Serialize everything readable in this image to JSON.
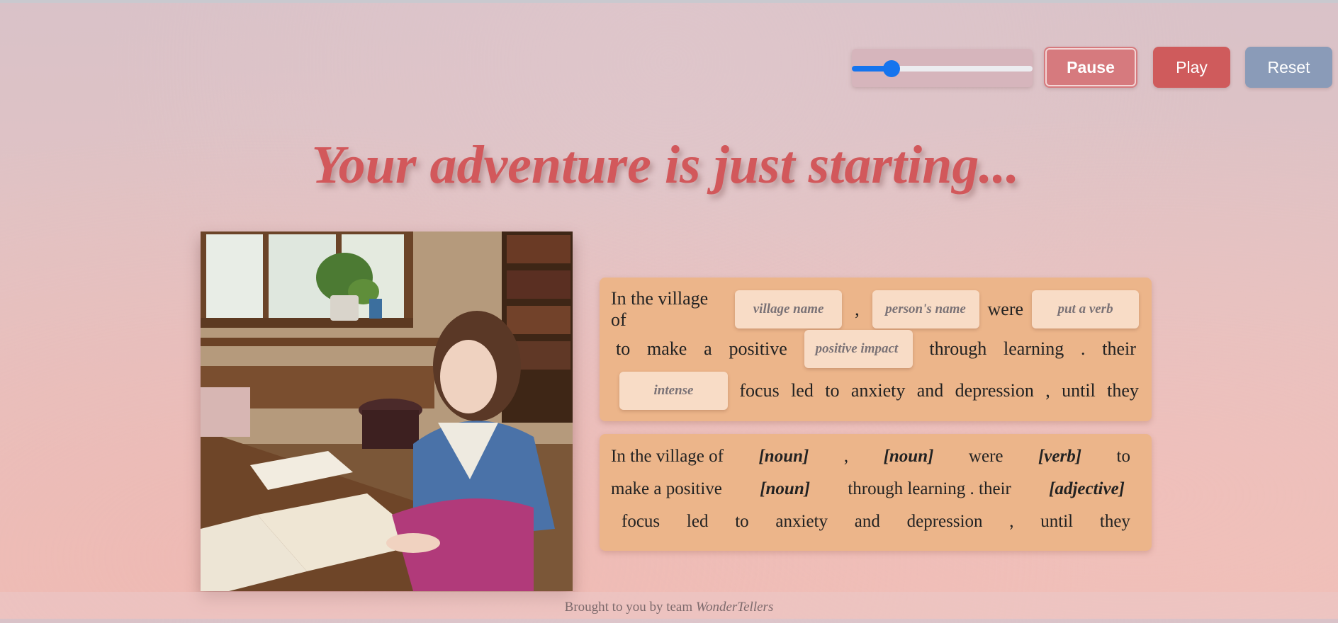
{
  "controls": {
    "slider_value": 0.22,
    "pause_label": "Pause",
    "play_label": "Play",
    "reset_label": "Reset"
  },
  "title": "Your adventure is just starting...",
  "story_inputs": {
    "t1": "In the village of",
    "village_placeholder": "village name",
    "t2": ",",
    "person_placeholder": "person's name",
    "t3": "were",
    "verb_placeholder": "put a verb",
    "t4": "to",
    "t5": "make",
    "t6": "a",
    "t7": "positive",
    "impact_placeholder": "positive impact",
    "t8": "through",
    "t9": "learning",
    "t10": ".",
    "t11": "their",
    "adjective_placeholder": "intense",
    "t12": "focus",
    "t13": "led",
    "t14": "to",
    "t15": "anxiety",
    "t16": "and",
    "t17": "depression",
    "t18": ",",
    "t19": "until",
    "t20": "they"
  },
  "story_template": {
    "a1": "In the village of",
    "b1": "[noun]",
    "a2": ",",
    "b2": "[noun]",
    "a3": "were",
    "b3": "[verb]",
    "a4": "to",
    "a5": "make a positive",
    "b4": "[noun]",
    "a6": "through learning . their",
    "b5": "[adjective]",
    "c1": "focus",
    "c2": "led",
    "c3": "to",
    "c4": "anxiety",
    "c5": "and",
    "c6": "depression",
    "c7": ",",
    "c8": "until",
    "c9": "they"
  },
  "footer": {
    "prefix": "Brought to you by team",
    "team": "WonderTellers"
  },
  "colors": {
    "title": "#d2585b",
    "card": "#ecb58a",
    "pill": "#f8dcc6",
    "slider": "#1574ee",
    "pause": "#d67a7e",
    "play": "#cf5b5c",
    "reset": "#8a9bb8"
  }
}
